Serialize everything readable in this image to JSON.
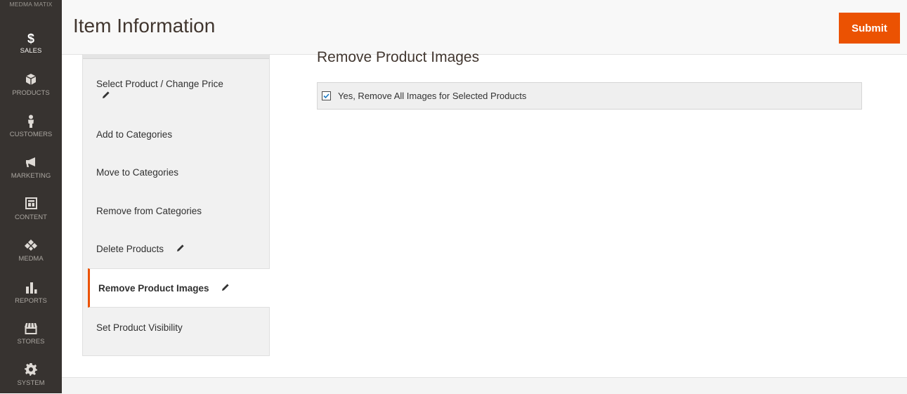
{
  "admin_menu": {
    "brand": "MEDMA MATIX",
    "items": [
      {
        "label": "SALES",
        "icon": "dollar-icon"
      },
      {
        "label": "PRODUCTS",
        "icon": "cube-icon"
      },
      {
        "label": "CUSTOMERS",
        "icon": "person-icon"
      },
      {
        "label": "MARKETING",
        "icon": "megaphone-icon"
      },
      {
        "label": "CONTENT",
        "icon": "layout-icon"
      },
      {
        "label": "MEDMA",
        "icon": "diamond-icon"
      },
      {
        "label": "REPORTS",
        "icon": "bar-chart-icon"
      },
      {
        "label": "STORES",
        "icon": "store-icon"
      },
      {
        "label": "SYSTEM",
        "icon": "gear-icon"
      }
    ]
  },
  "header": {
    "title": "Item Information",
    "submit_label": "Submit"
  },
  "tabs": [
    {
      "label": "Select Product / Change Price",
      "edited": true
    },
    {
      "label": "Add to Categories",
      "edited": false
    },
    {
      "label": "Move to Categories",
      "edited": false
    },
    {
      "label": "Remove from Categories",
      "edited": false
    },
    {
      "label": "Delete Products",
      "edited": true
    },
    {
      "label": "Remove Product Images",
      "edited": true,
      "active": true
    },
    {
      "label": "Set Product Visibility",
      "edited": false
    }
  ],
  "content": {
    "section_title": "Remove Product Images",
    "option": {
      "label": "Yes, Remove All Images for Selected Products",
      "checked": true
    }
  },
  "colors": {
    "accent": "#eb5202",
    "sidebar": "#373330"
  }
}
